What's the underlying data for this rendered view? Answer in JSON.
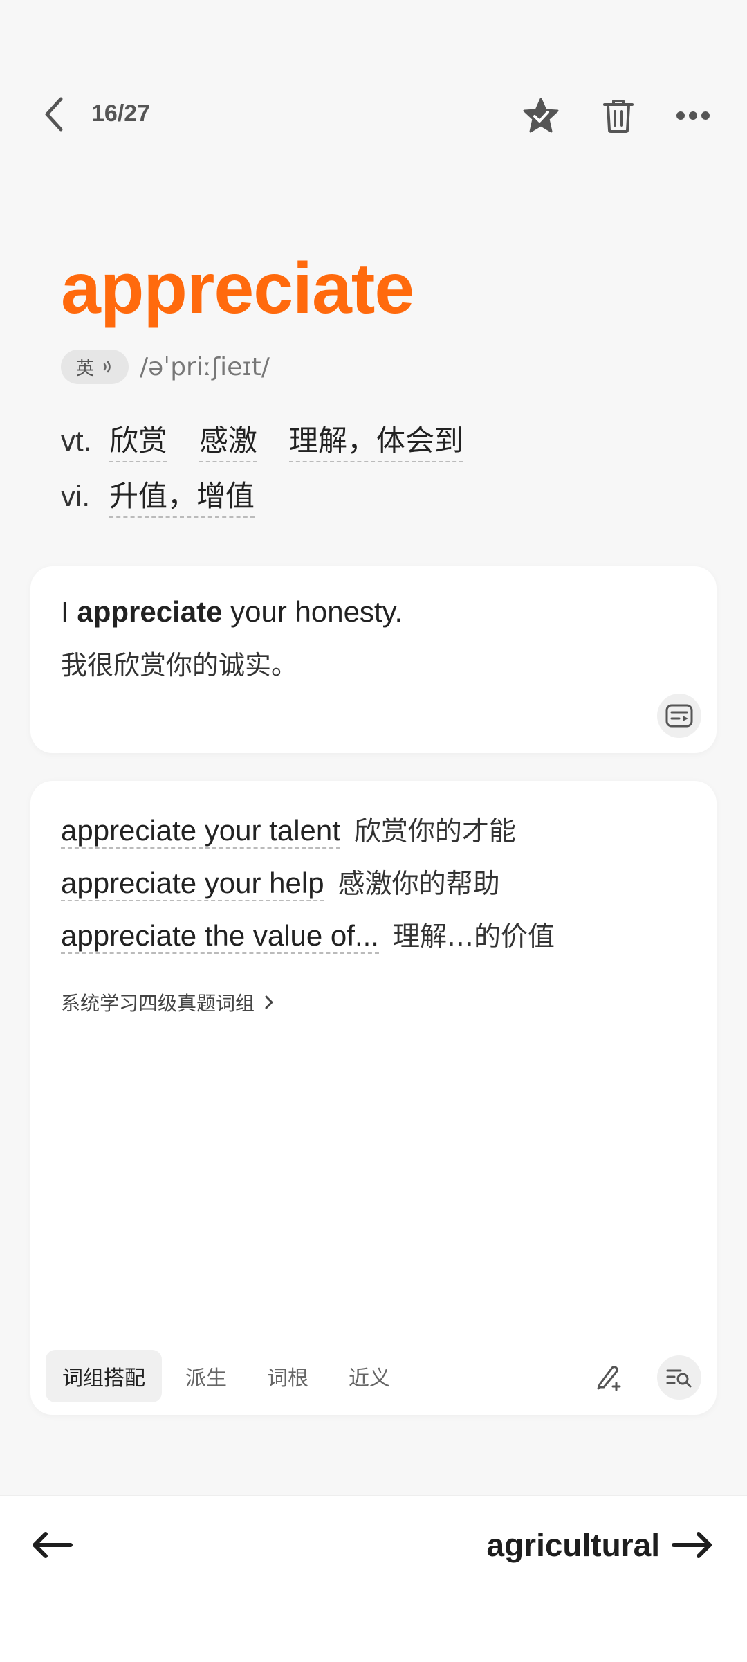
{
  "header": {
    "counter": "16/27",
    "icons": [
      "back-icon",
      "star-check-icon",
      "trash-icon",
      "more-icon"
    ]
  },
  "word": {
    "text": "appreciate",
    "accent_label": "英",
    "phonetic": "/əˈpriːʃieɪt/",
    "definitions": [
      {
        "pos": "vt.",
        "meanings": [
          "欣赏",
          "感激",
          "理解，体会到"
        ]
      },
      {
        "pos": "vi.",
        "meanings": [
          "升值，增值"
        ]
      }
    ]
  },
  "example": {
    "en_before": "I ",
    "en_bold": "appreciate",
    "en_after": " your honesty.",
    "zh": "我很欣赏你的诚实。"
  },
  "phrases": {
    "items": [
      {
        "en": "appreciate your talent",
        "zh": "欣赏你的才能"
      },
      {
        "en": "appreciate your help",
        "zh": "感激你的帮助"
      },
      {
        "en": "appreciate the value of...",
        "zh": "理解…的价值"
      }
    ],
    "learn_link": "系统学习四级真题词组",
    "tabs": [
      "词组搭配",
      "派生",
      "词根",
      "近义"
    ],
    "active_tab": 0
  },
  "footer": {
    "next_word": "agricultural"
  },
  "colors": {
    "accent": "#ff6a0d",
    "background": "#f7f7f7",
    "card": "#ffffff"
  }
}
